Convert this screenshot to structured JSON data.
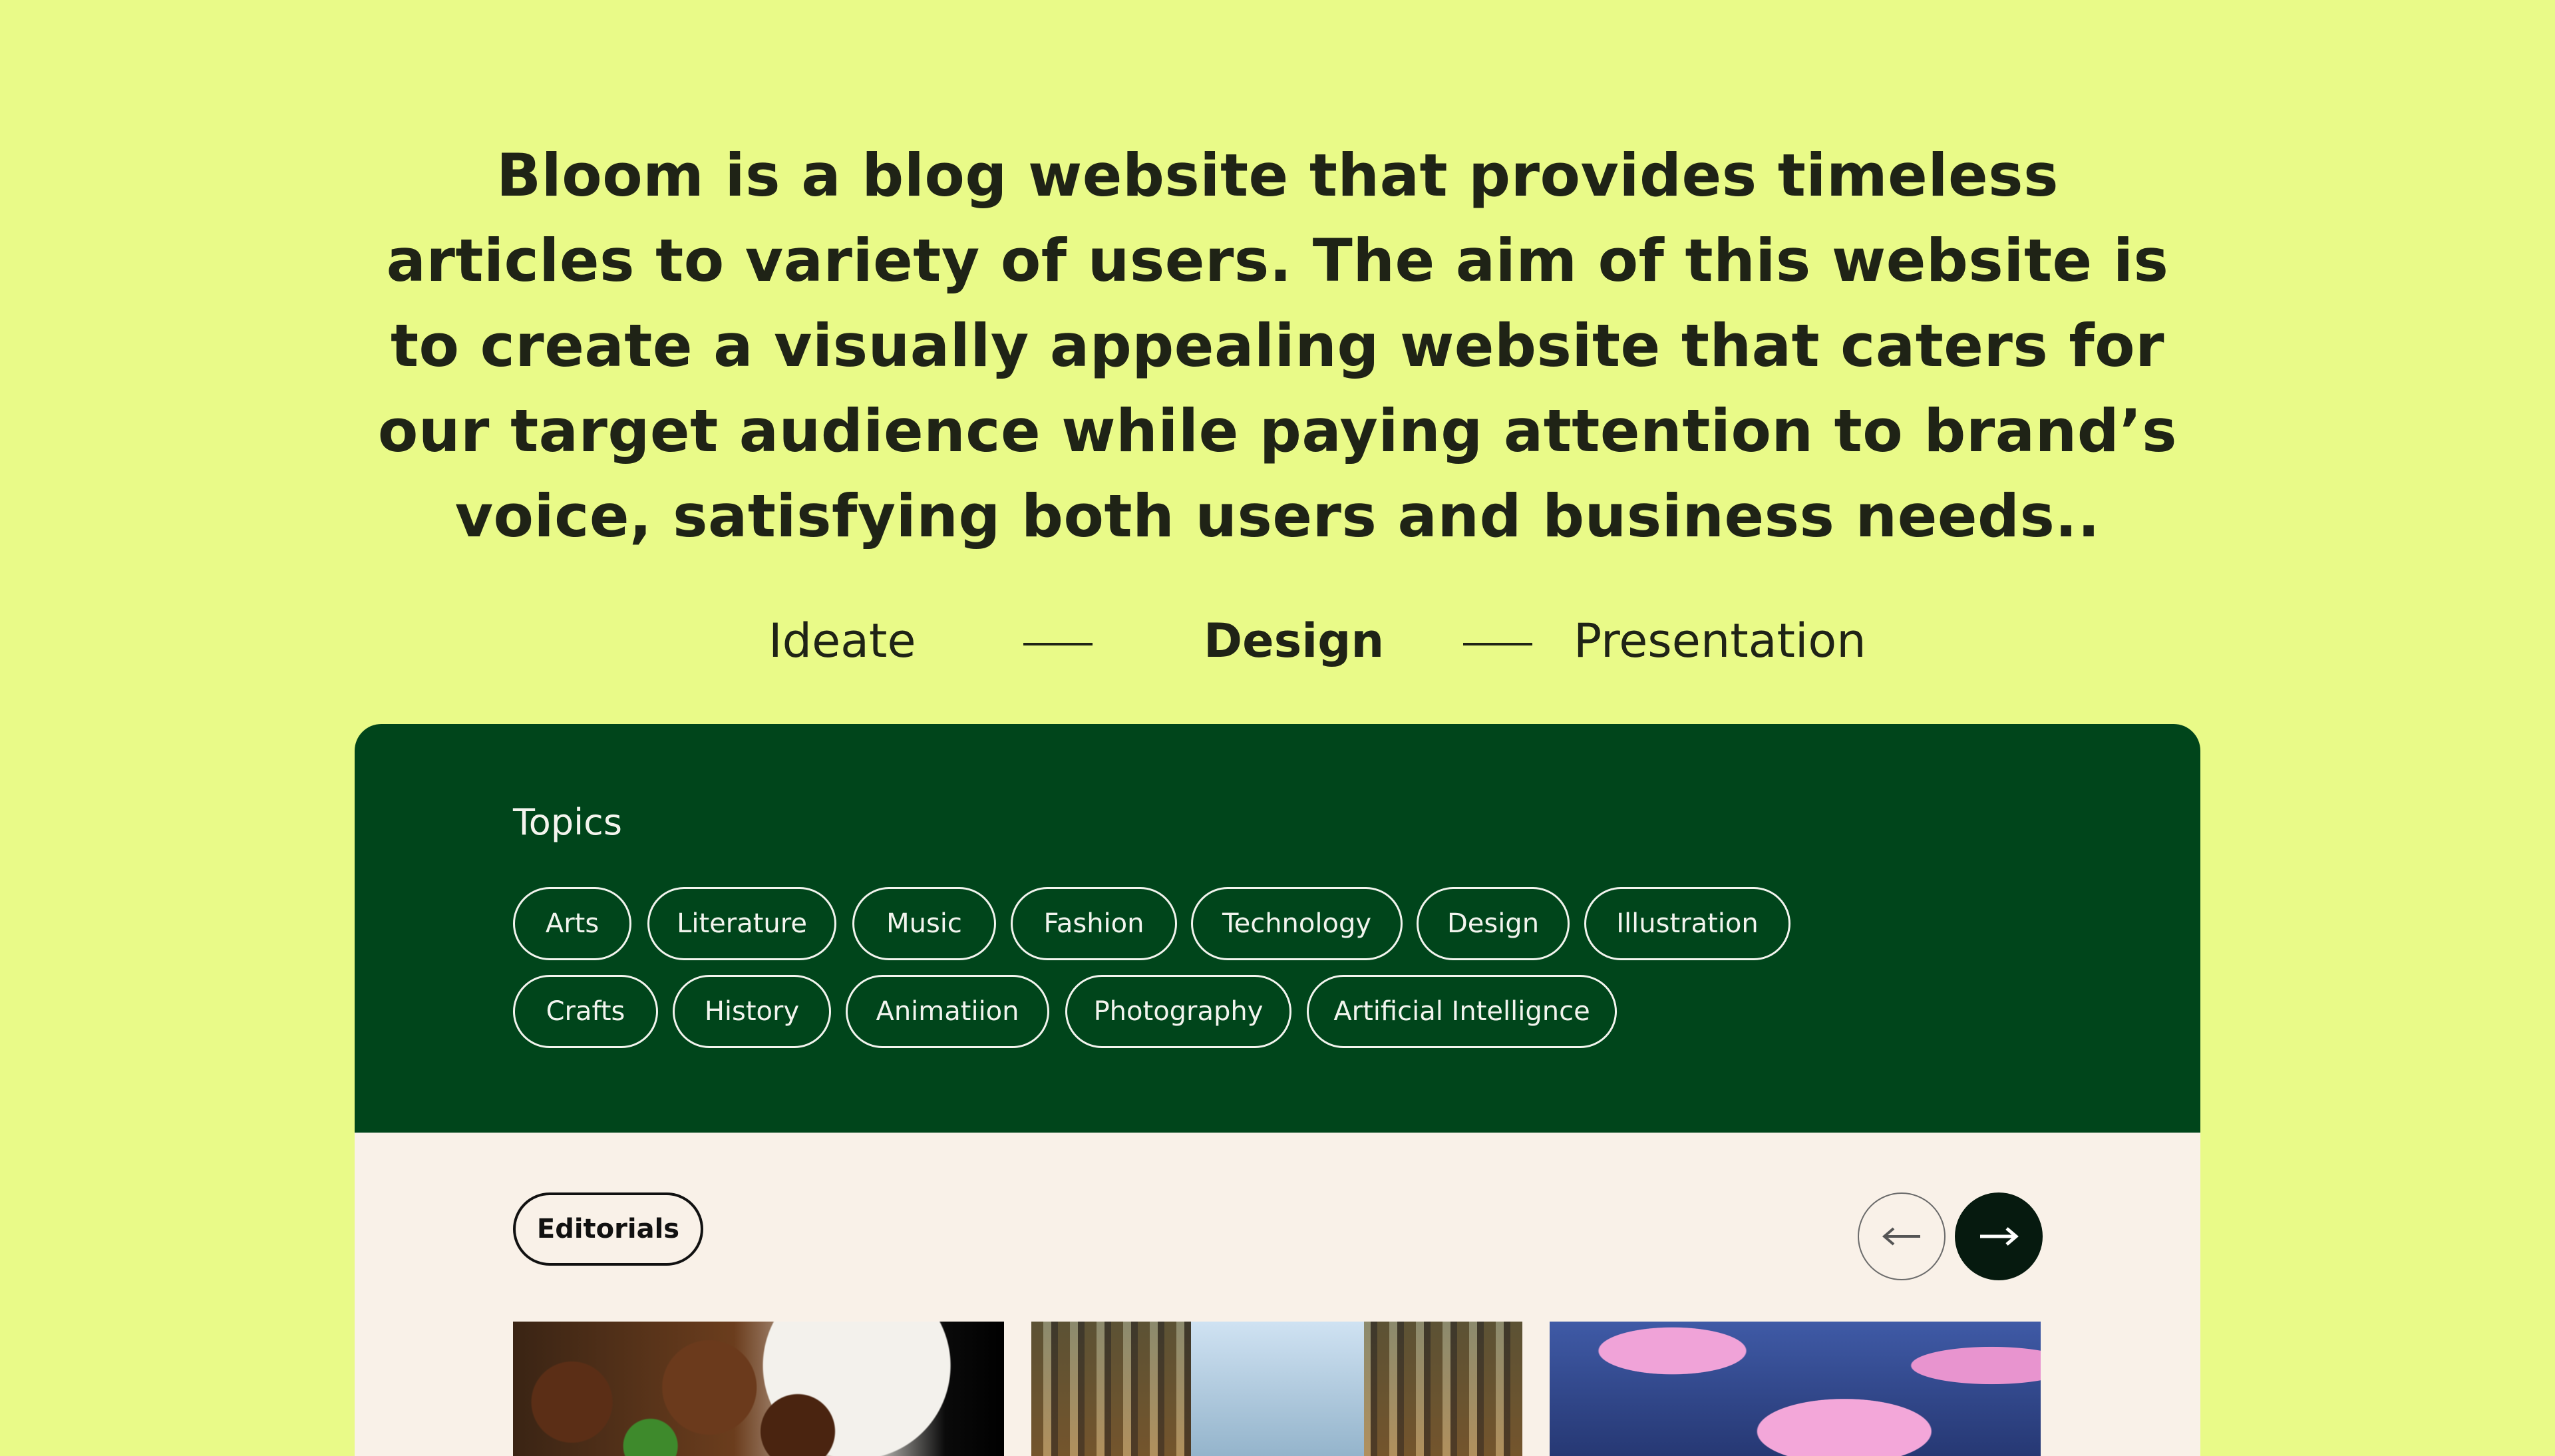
{
  "intro": {
    "text": "Bloom is a blog website that provides timeless articles to variety of users. The aim of this website is to create a visually appealing website that caters for our target audience while paying attention to brand’s voice, satisfying both users and business needs.."
  },
  "process": {
    "steps": [
      "Ideate",
      "Design",
      "Presentation"
    ],
    "active": "Design"
  },
  "topics": {
    "title": "Topics",
    "row1": [
      "Arts",
      "Literature",
      "Music",
      "Fashion",
      "Technology",
      "Design",
      "Illustration"
    ],
    "row2": [
      "Crafts",
      "History",
      "Animatiion",
      "Photography",
      "Artificial Intellignce"
    ]
  },
  "editorials": {
    "label": "Editorials",
    "prev_icon": "arrow-left-icon",
    "next_icon": "arrow-right-icon",
    "thumbnails": [
      "food-image",
      "library-image",
      "piggy-bank-image"
    ]
  },
  "colors": {
    "background": "#e9fa88",
    "topics_panel": "#00451b",
    "editorials_panel": "#f9f1e8",
    "text_dark": "#1f2316",
    "next_button": "#061a0f"
  }
}
